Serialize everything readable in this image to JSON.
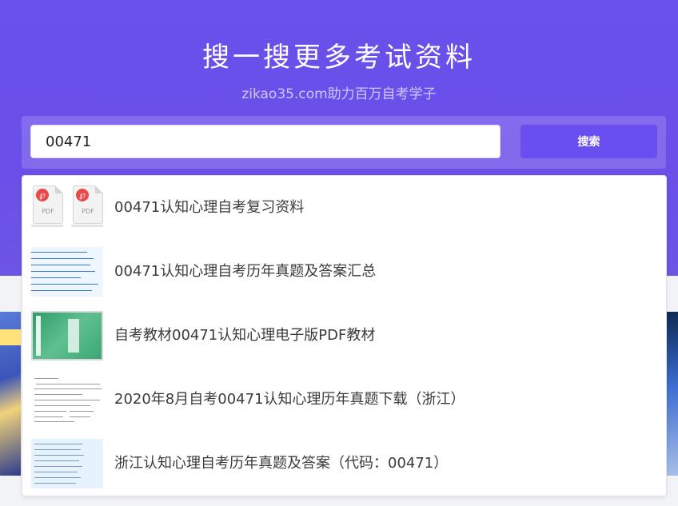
{
  "hero": {
    "title": "搜一搜更多考试资料",
    "subtitle": "zikao35.com助力百万自考学子"
  },
  "search": {
    "value": "00471",
    "button_label": "搜索"
  },
  "suggestions": [
    {
      "label": "00471认知心理自考复习资料",
      "thumb": "pdf-files"
    },
    {
      "label": "00471认知心理自考历年真题及答案汇总",
      "thumb": "file-list"
    },
    {
      "label": "自考教材00471认知心理电子版PDF教材",
      "thumb": "textbook-cover"
    },
    {
      "label": "2020年8月自考00471认知心理历年真题下载（浙江）",
      "thumb": "exam-paper"
    },
    {
      "label": "浙江认知心理自考历年真题及答案（代码：00471）",
      "thumb": "answer-list"
    }
  ],
  "thumb_pdf": {
    "icon_label": "PDF"
  },
  "colors": {
    "hero_bg": "#6a50ec",
    "button_bg": "#6a4ff0",
    "pdf_badge": "#e9494a"
  }
}
